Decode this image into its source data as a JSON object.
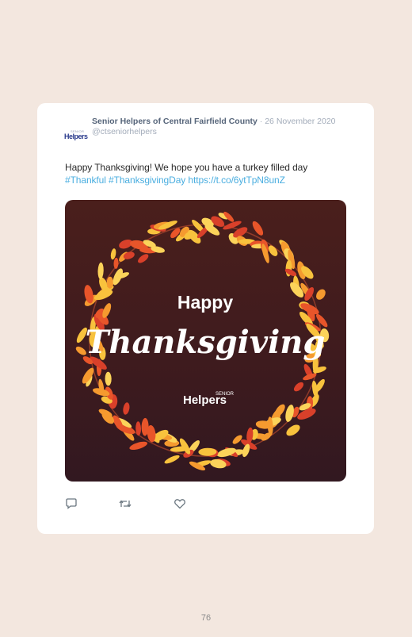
{
  "tweet": {
    "author_name": "Senior Helpers of Central Fairfield County",
    "separator": " · ",
    "date": "26 November 2020",
    "handle": "@ctseniorhelpers",
    "avatar_small": "SENIOR",
    "avatar_large": "Helpers",
    "text_main": "Happy Thanksgiving! We hope you have a turkey filled day",
    "hashtag1": "#Thankful",
    "hashtag2": "#ThanksgivingDay",
    "url": "https://t.co/6ytTpN8unZ"
  },
  "media": {
    "line1": "Happy",
    "line2": "Thanksgiving",
    "brand_small": "SENIOR",
    "brand_large": "Helpers",
    "leaf_colors": [
      "#f59a2f",
      "#e8552a",
      "#f8c23d",
      "#d9402a",
      "#fbd35a"
    ],
    "branch_color": "#b0472d"
  },
  "actions": [
    "reply-icon",
    "retweet-icon",
    "like-icon"
  ],
  "page": {
    "number": "76"
  },
  "colors": {
    "background": "#f3e7df",
    "link": "#4aaee0",
    "name": "#56657a"
  }
}
